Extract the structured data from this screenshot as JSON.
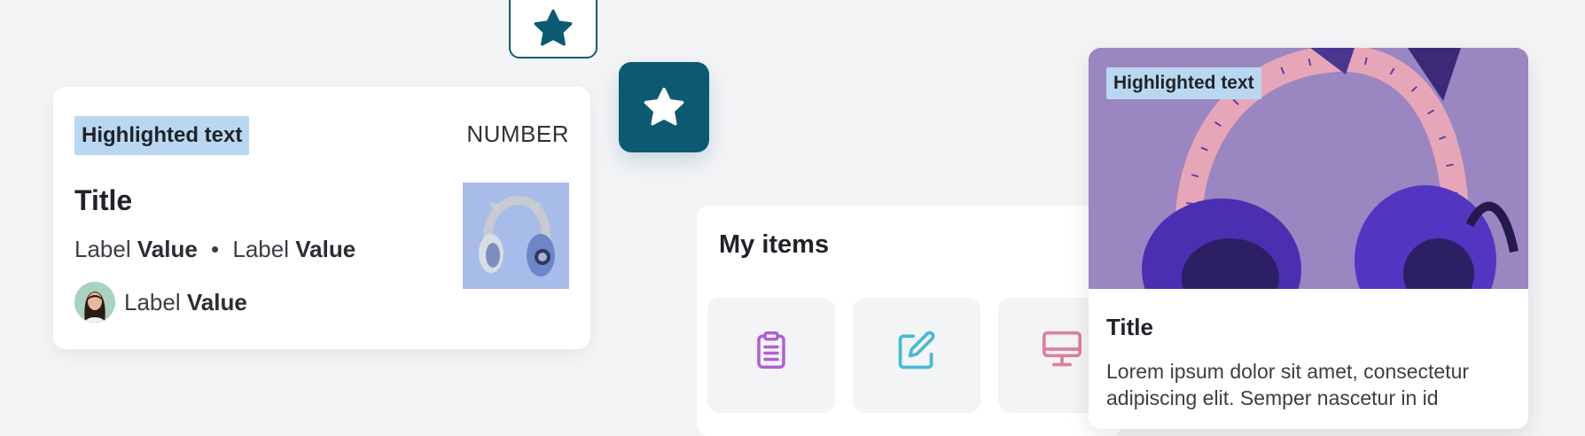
{
  "colors": {
    "background": "#f3f4f6",
    "accent": "#0b5a72",
    "highlight": "#b9d7f0",
    "card": "#ffffff"
  },
  "star_buttons": [
    {
      "icon": "star-icon",
      "style": "outlined"
    },
    {
      "icon": "star-icon",
      "style": "filled"
    }
  ],
  "list_card": {
    "tag": "Highlighted text",
    "number": "NUMBER",
    "title": "Title",
    "meta": [
      {
        "label": "Label",
        "value": "Value"
      },
      {
        "label": "Label",
        "value": "Value"
      }
    ],
    "separator": "•",
    "person": {
      "label": "Label",
      "value": "Value"
    },
    "thumbnail": "headphones-image"
  },
  "items_panel": {
    "title": "My items",
    "tiles": [
      {
        "icon": "clipboard-icon",
        "color": "#b05ed6"
      },
      {
        "icon": "edit-icon",
        "color": "#47b9d4"
      },
      {
        "icon": "monitor-icon",
        "color": "#db7fa0"
      }
    ]
  },
  "product_card": {
    "tag": "Highlighted text",
    "title": "Title",
    "description": "Lorem ipsum dolor sit amet, consectetur adipiscing elit. Semper nascetur in id"
  }
}
